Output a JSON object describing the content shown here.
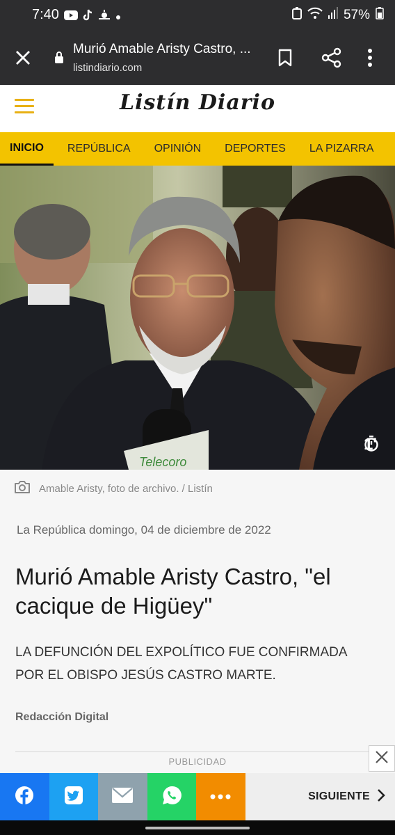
{
  "status_bar": {
    "time": "7:40",
    "battery": "57%",
    "left_icons": [
      "youtube-icon",
      "tiktok-icon",
      "weather-icon",
      "dot-icon"
    ],
    "right_icons": [
      "alarm-icon",
      "wifi-icon",
      "signal-icon",
      "battery-icon"
    ]
  },
  "browser": {
    "page_title": "Murió Amable Aristy Castro, ...",
    "url": "listindiario.com"
  },
  "site": {
    "logo": "Listín Diario",
    "brand_color": "#f3c300"
  },
  "nav": {
    "items": [
      {
        "label": "INICIO",
        "active": true
      },
      {
        "label": "REPÚBLICA",
        "active": false
      },
      {
        "label": "OPINIÓN",
        "active": false
      },
      {
        "label": "DEPORTES",
        "active": false
      },
      {
        "label": "LA PIZARRA",
        "active": false
      }
    ]
  },
  "hero": {
    "read_time": "1'",
    "caption": "Amable Aristy, foto de archivo. / Listín"
  },
  "article": {
    "meta": "La República domingo, 04 de diciembre de 2022",
    "headline": "Murió Amable Aristy Castro, \"el cacique de Higüey\"",
    "subtitle": "LA DEFUNCIÓN DEL EXPOLÍTICO FUE CONFIRMADA POR EL OBISPO JESÚS CASTRO MARTE.",
    "author": "Redacción Digital"
  },
  "ad": {
    "label": "PUBLICIDAD"
  },
  "share_bar": {
    "buttons": [
      {
        "name": "facebook",
        "color": "#1877f2"
      },
      {
        "name": "twitter",
        "color": "#1da1f2"
      },
      {
        "name": "email",
        "color": "#8fa2ad"
      },
      {
        "name": "whatsapp",
        "color": "#25d366"
      },
      {
        "name": "more",
        "color": "#f28c00"
      }
    ],
    "next_label": "SIGUIENTE"
  }
}
